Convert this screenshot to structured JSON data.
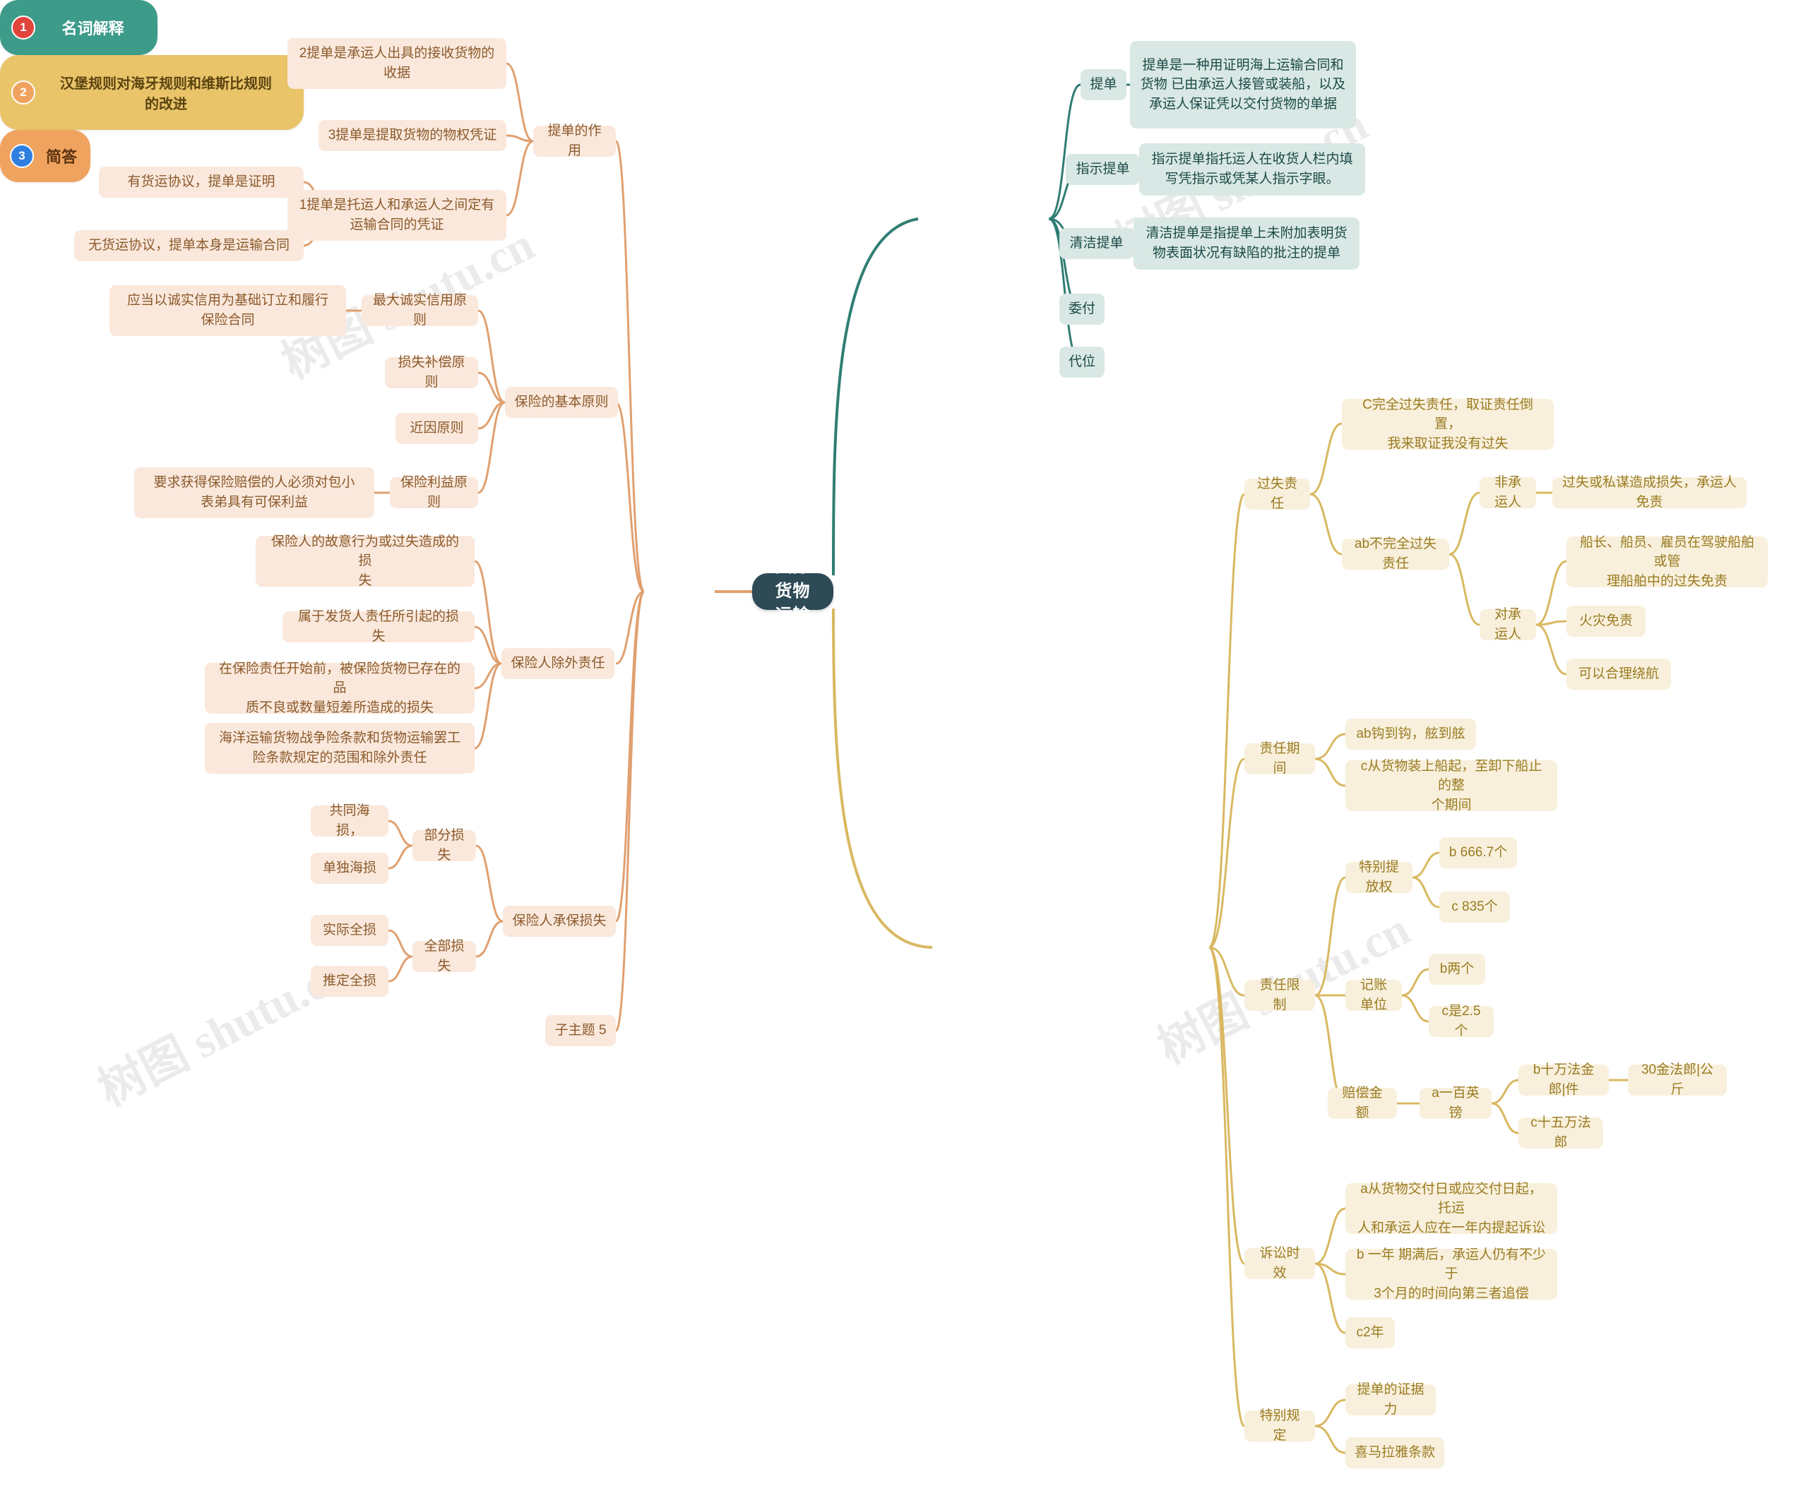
{
  "root": {
    "label": "国际货物运输"
  },
  "watermark": {
    "text": "树图 shutu.cn"
  },
  "branches": [
    {
      "id": "b1",
      "index": "1",
      "label": "名词解释",
      "color": "#3d9b8a",
      "badge_color": "#e0443b"
    },
    {
      "id": "b2",
      "index": "2",
      "label": "汉堡规则对海牙规则和维斯比规则\n的改进",
      "color": "#e9c469",
      "badge_color": "#f0a35e"
    },
    {
      "id": "b3",
      "index": "3",
      "label": "简答",
      "color": "#f0a35e",
      "badge_color": "#2f7fe0"
    }
  ],
  "nodes": {
    "tidan": "提单",
    "tidan_def": "提单是一种用证明海上运输合同和\n货物 已由承运人接管或装船，以及\n承运人保证凭以交付货物的单据",
    "zhishi_tidan": "指示提单",
    "zhishi_tidan_def": "指示提单指托运人在收货人栏内填\n写凭指示或凭某人指示字眼。",
    "qingjie_tidan": "清洁提单",
    "qingjie_tidan_def": "清洁提单是指提单上未附加表明货\n物表面状况有缺陷的批注的提单",
    "weifu": "委付",
    "daiwei": "代位",
    "guoshi_zeren": "过失责任",
    "guoshi_c": "C完全过失责任，取证责任倒置，\n我来取证我没有过失",
    "guoshi_ab": "ab不完全过失责任",
    "fei_chengyunren": "非承运人",
    "fei_chengyunren_d": "过失或私谋造成损失，承运人免责",
    "dui_chengyunren": "对承运人",
    "dui_1": "船长、船员、雇员在驾驶船舶或管\n理船舶中的过失免责",
    "dui_2": "火灾免责",
    "dui_3": "可以合理绕航",
    "zeren_qijian": "责任期间",
    "zq_ab": "ab钩到钩，舷到舷",
    "zq_c": "c从货物装上船起，至卸下船止的整\n个期间",
    "zeren_xianzhi": "责任限制",
    "tebie_tifangquan": "特别提放权",
    "tfq_b": "b 666.7个",
    "tfq_c": "c 835个",
    "jizhang_danwei": "记账单位",
    "jzd_b": "b两个",
    "jzd_c": "c是2.5个",
    "peichang_jine": "赔偿金额",
    "pcj_a": "a一百英镑",
    "pcj_b": "b十万法金郎|件",
    "pcj_b2": "30金法郎|公斤",
    "pcj_c": "c十五万法郎",
    "susong_shixiao": "诉讼时效",
    "ss_a": "a从货物交付日或应交付日起，托运\n人和承运人应在一年内提起诉讼",
    "ss_b": "b 一年 期满后，承运人仍有不少于\n3个月的时间向第三者追偿",
    "ss_c": "c2年",
    "tebie_guiding": "特别规定",
    "tg_1": "提单的证据力",
    "tg_2": "喜马拉雅条款",
    "tidan_zuoyong": "提单的作用",
    "tz_2": "2提单是承运人出具的接收货物的\n收据",
    "tz_3": "3提单是提取货物的物权凭证",
    "tz_1": "1提单是托运人和承运人之间定有\n运输合同的凭证",
    "tz_1a": "有货运协议，提单是证明",
    "tz_1b": "无货运协议，提单本身是运输合同",
    "baoxian_jiben": "保险的基本原则",
    "bj_1": "最大诚实信用原则",
    "bj_1d": "应当以诚实信用为基础订立和履行\n保险合同",
    "bj_2": "损失补偿原则",
    "bj_3": "近因原则",
    "bj_4": "保险利益原则",
    "bj_4d": "要求获得保险赔偿的人必须对包小\n表弟具有可保利益",
    "chuwai_zeren": "保险人除外责任",
    "cw_1": "保险人的故意行为或过失造成的损\n失",
    "cw_2": "属于发货人责任所引起的损失",
    "cw_3": "在保险责任开始前，被保险货物已存在的品\n质不良或数量短差所造成的损失",
    "cw_4": "海洋运输货物战争险条款和货物运输罢工\n险条款规定的范围和除外责任",
    "chengbao_sunshi": "保险人承保损失",
    "cb_bufen": "部分损失",
    "cb_b1": "共同海损，",
    "cb_b2": "单独海损",
    "cb_quanbu": "全部损失",
    "cb_q1": "实际全损",
    "cb_q2": "推定全损",
    "zizhuti5": "子主题 5"
  },
  "colors": {
    "root_bg": "#2d4a55",
    "teal_node": "#d9e8e4",
    "teal_text": "#1b4a47",
    "orange_node": "#fae8dc",
    "orange_text": "#8b5a2b",
    "yellow_node": "#f8f0dc",
    "yellow_text": "#9a7b22",
    "teal_line": "#2f7d73",
    "orange_line": "#e0a070",
    "yellow_line": "#d9b861"
  }
}
